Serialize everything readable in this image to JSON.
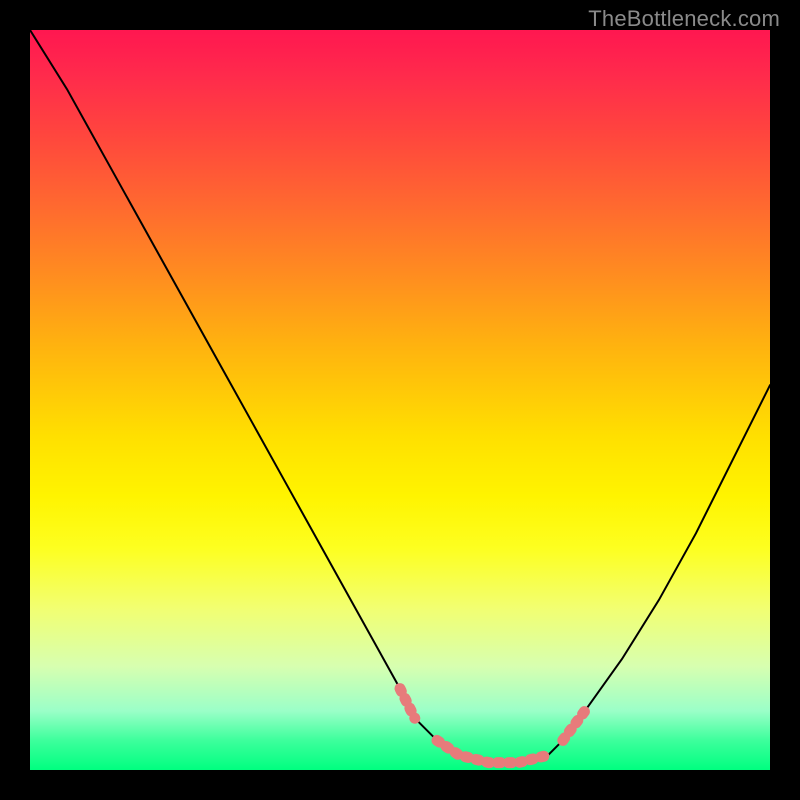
{
  "watermark": "TheBottleneck.com",
  "colors": {
    "curve": "#000000",
    "highlight": "#e77b7b",
    "frame": "#000000"
  },
  "chart_data": {
    "type": "line",
    "title": "",
    "xlabel": "",
    "ylabel": "",
    "xlim": [
      0,
      100
    ],
    "ylim": [
      0,
      100
    ],
    "grid": false,
    "series": [
      {
        "name": "bottleneck-curve",
        "x": [
          0,
          5,
          10,
          15,
          20,
          25,
          30,
          35,
          40,
          45,
          50,
          52,
          55,
          58,
          62,
          66,
          70,
          72,
          75,
          80,
          85,
          90,
          95,
          100
        ],
        "y": [
          100,
          92,
          83,
          74,
          65,
          56,
          47,
          38,
          29,
          20,
          11,
          7,
          4,
          2,
          1,
          1,
          2,
          4,
          8,
          15,
          23,
          32,
          42,
          52
        ]
      }
    ],
    "highlight_segments": [
      {
        "x_start": 50,
        "x_end": 52,
        "y_start": 11,
        "y_end": 7
      },
      {
        "x_start": 55,
        "x_end": 70,
        "y_start": 4,
        "y_end": 2
      },
      {
        "x_start": 72,
        "x_end": 75,
        "y_start": 4,
        "y_end": 8
      }
    ]
  }
}
